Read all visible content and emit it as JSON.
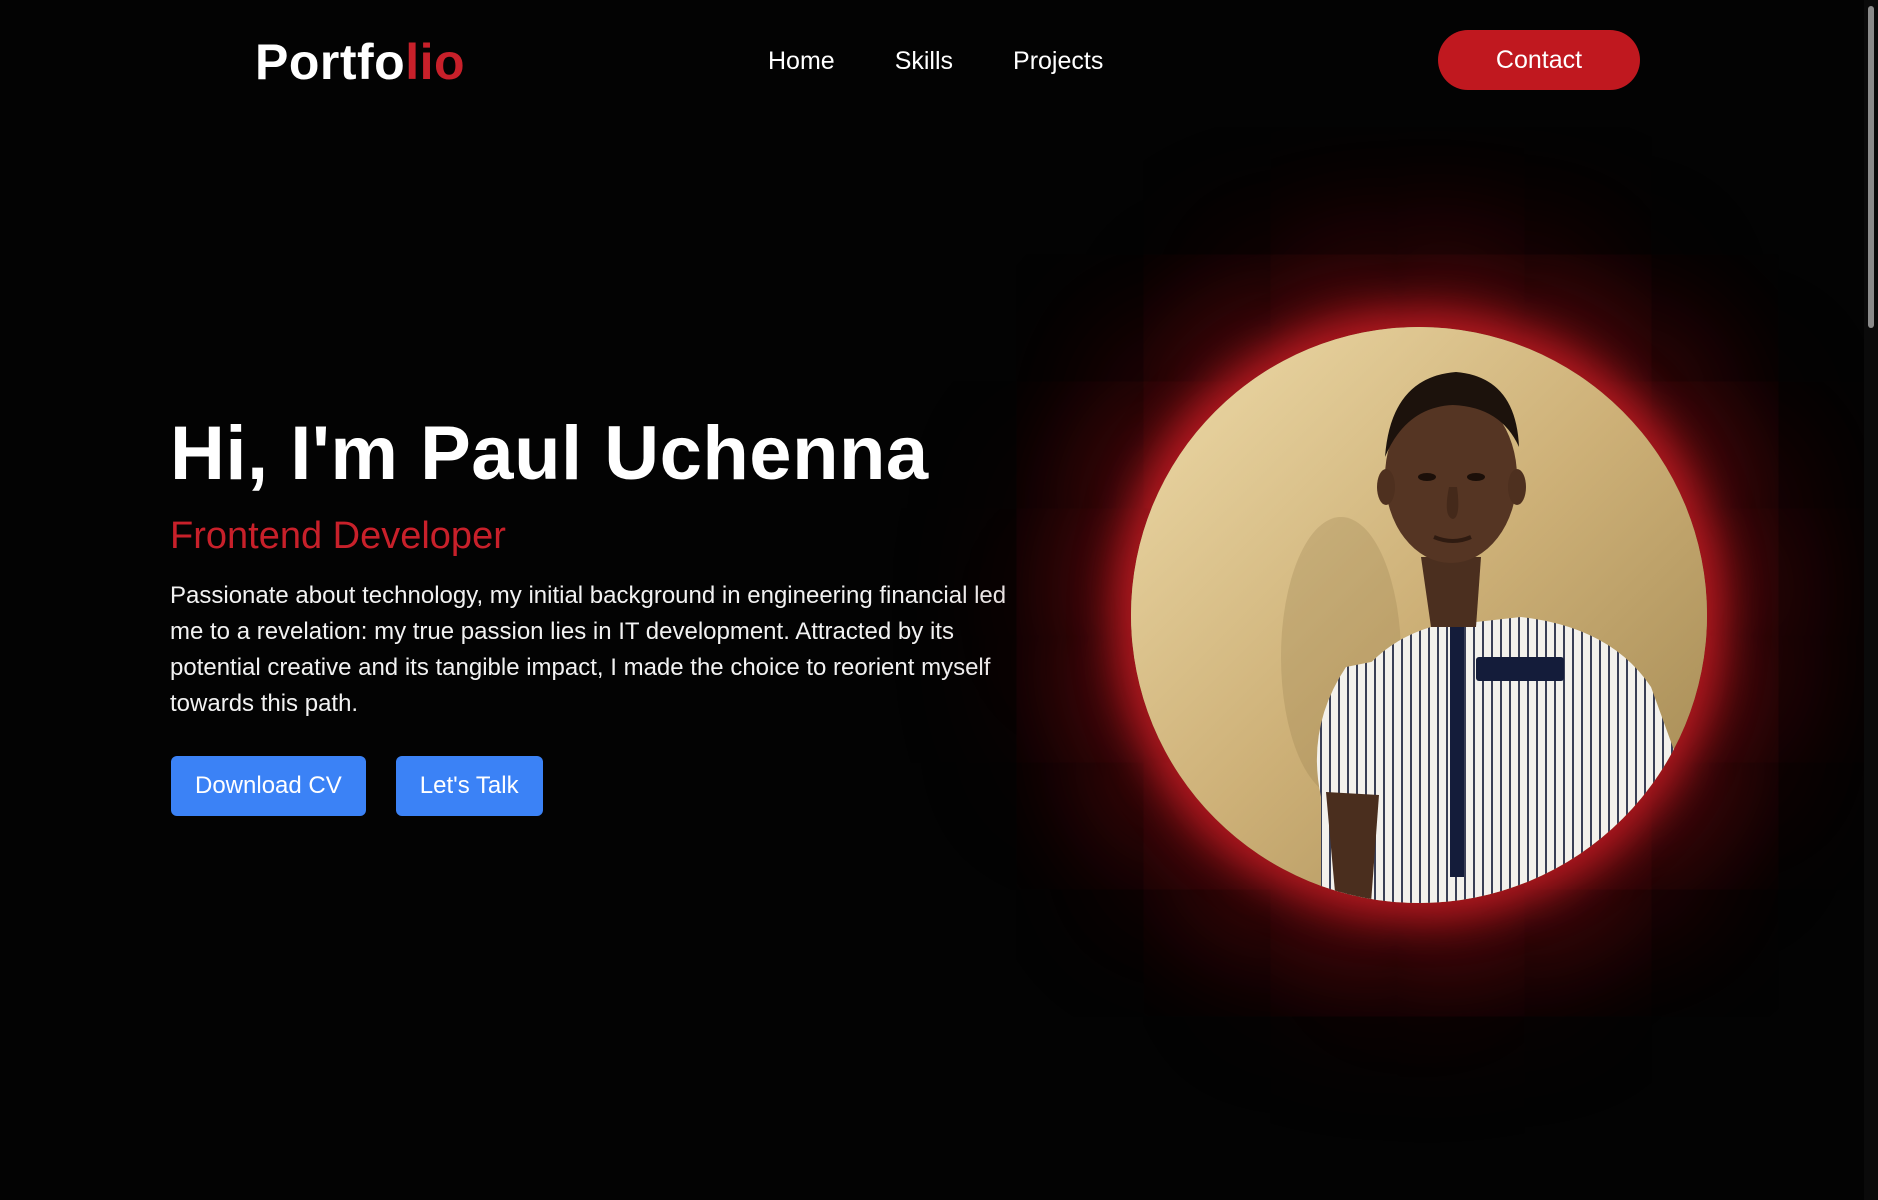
{
  "logo": {
    "main": "Portfo",
    "accent": "lio"
  },
  "nav": {
    "items": [
      {
        "label": "Home"
      },
      {
        "label": "Skills"
      },
      {
        "label": "Projects"
      }
    ],
    "contact_label": "Contact"
  },
  "hero": {
    "title": "Hi, I'm Paul Uchenna",
    "role": "Frontend Developer",
    "description": "Passionate about technology, my initial background in engineering financial led me to a revelation: my true passion lies in IT development. Attracted by its potential creative and its tangible impact, I made the choice to reorient myself towards this path.",
    "download_cv_label": "Download CV",
    "lets_talk_label": "Let's Talk"
  },
  "portrait": {
    "icon": "profile-photo"
  },
  "colors": {
    "accent": "#c8202a",
    "button_blue": "#3b82f6",
    "background": "#030303"
  }
}
